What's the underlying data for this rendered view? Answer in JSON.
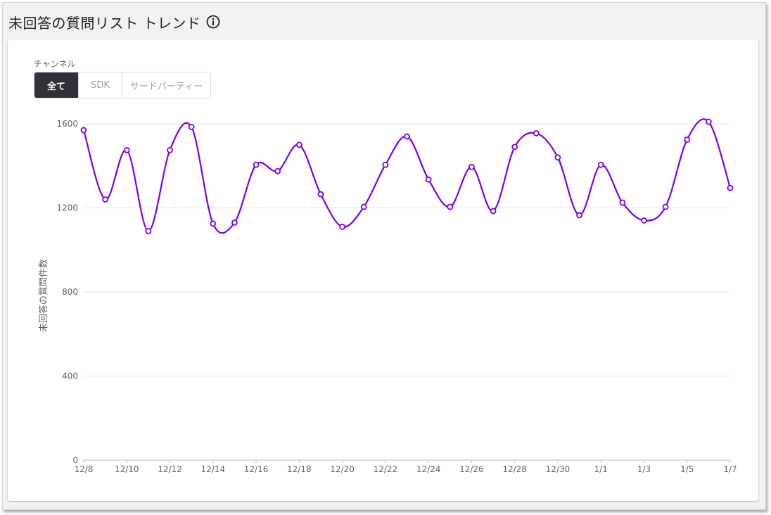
{
  "header": {
    "title": "未回答の質問リスト トレンド",
    "info_icon": "info-icon"
  },
  "filter": {
    "label": "チャンネル",
    "options": [
      {
        "label": "全て",
        "active": true
      },
      {
        "label": "SDK",
        "active": false
      },
      {
        "label": "サードパーティー",
        "active": false
      }
    ]
  },
  "colors": {
    "line": "#7b00e6",
    "active_toggle": "#2d3339",
    "grid": "#e6e6e6"
  },
  "chart_data": {
    "type": "line",
    "ylabel": "未回答の質問件数",
    "xlabel": "",
    "ylim": [
      0,
      1600
    ],
    "yticks": [
      0,
      400,
      800,
      1200,
      1600
    ],
    "grid": true,
    "x_tick_labels": [
      "12/8",
      "12/10",
      "12/12",
      "12/14",
      "12/16",
      "12/18",
      "12/20",
      "12/22",
      "12/24",
      "12/26",
      "12/28",
      "12/30",
      "1/1",
      "1/3",
      "1/5",
      "1/7"
    ],
    "x": [
      "12/8",
      "12/9",
      "12/10",
      "12/11",
      "12/12",
      "12/13",
      "12/14",
      "12/15",
      "12/16",
      "12/17",
      "12/18",
      "12/19",
      "12/20",
      "12/21",
      "12/22",
      "12/23",
      "12/24",
      "12/25",
      "12/26",
      "12/27",
      "12/28",
      "12/29",
      "12/30",
      "12/31",
      "1/1",
      "1/2",
      "1/3",
      "1/4",
      "1/5",
      "1/6",
      "1/7"
    ],
    "series": [
      {
        "values": [
          1570,
          1240,
          1475,
          1090,
          1475,
          1585,
          1125,
          1130,
          1405,
          1375,
          1500,
          1265,
          1110,
          1205,
          1405,
          1540,
          1335,
          1205,
          1395,
          1185,
          1490,
          1555,
          1440,
          1165,
          1405,
          1225,
          1140,
          1205,
          1525,
          1610,
          1295
        ]
      }
    ]
  }
}
